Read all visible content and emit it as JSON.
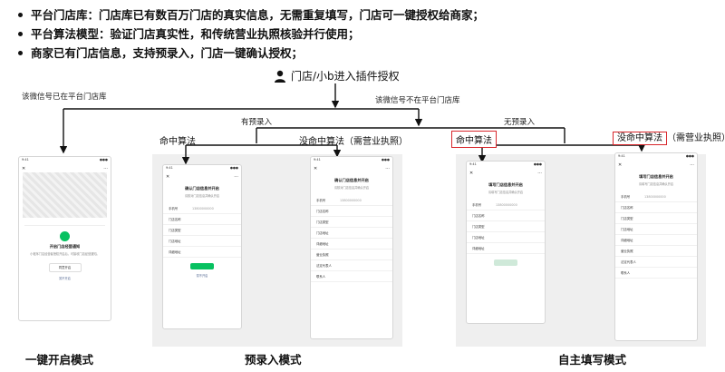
{
  "bullets": [
    "平台门店库：门店库已有数百万门店的真实信息，无需重复填写，门店可一键授权给商家；",
    "平台算法模型：验证门店真实性，和传统营业执照核验并行使用；",
    "商家已有门店信息，支持预录入，门店一键确认授权；"
  ],
  "diagram": {
    "root_label": "门店/小b进入插件授权",
    "left_label": "该微信号已在平台门店库",
    "right_label": "该微信号不在平台门店库",
    "pre_entry": "有预录入",
    "no_pre_entry": "无预录入",
    "hit": "命中算法",
    "miss": "没命中算法（需营业执照）",
    "hit_boxed": "命中算法",
    "miss_boxed": "没命中算法",
    "miss_boxed_suffix": "（需营业执照）",
    "accent_color": "#d8262b"
  },
  "captions": {
    "one_click": "一键开启模式",
    "pre_entry": "预录入模式",
    "self_fill": "自主填写模式"
  },
  "phones": {
    "notice_title": "开启门店经营通知",
    "notice_body": "小程序门店经营者授权开启后，可接收门店经营通知。",
    "notice_button": "同意开启",
    "notice_link": "暂不开启",
    "prefill_title": "确认门店信息并开启",
    "prefill_sub": "请核对门店信息并确认开启",
    "fill_title": "填写门店信息并开启",
    "fill_sub": "请填写门店信息并确认开启",
    "field_phone": "手机号",
    "field_name": "门店名称",
    "field_type": "门店类型",
    "field_address": "门店地址",
    "field_detail": "详细地址",
    "field_license": "营业执照",
    "field_legal": "法定代表人",
    "field_contact": "联系人",
    "phone_value": "13800000000",
    "confirm": "确认",
    "cancel": "暂不开启"
  }
}
